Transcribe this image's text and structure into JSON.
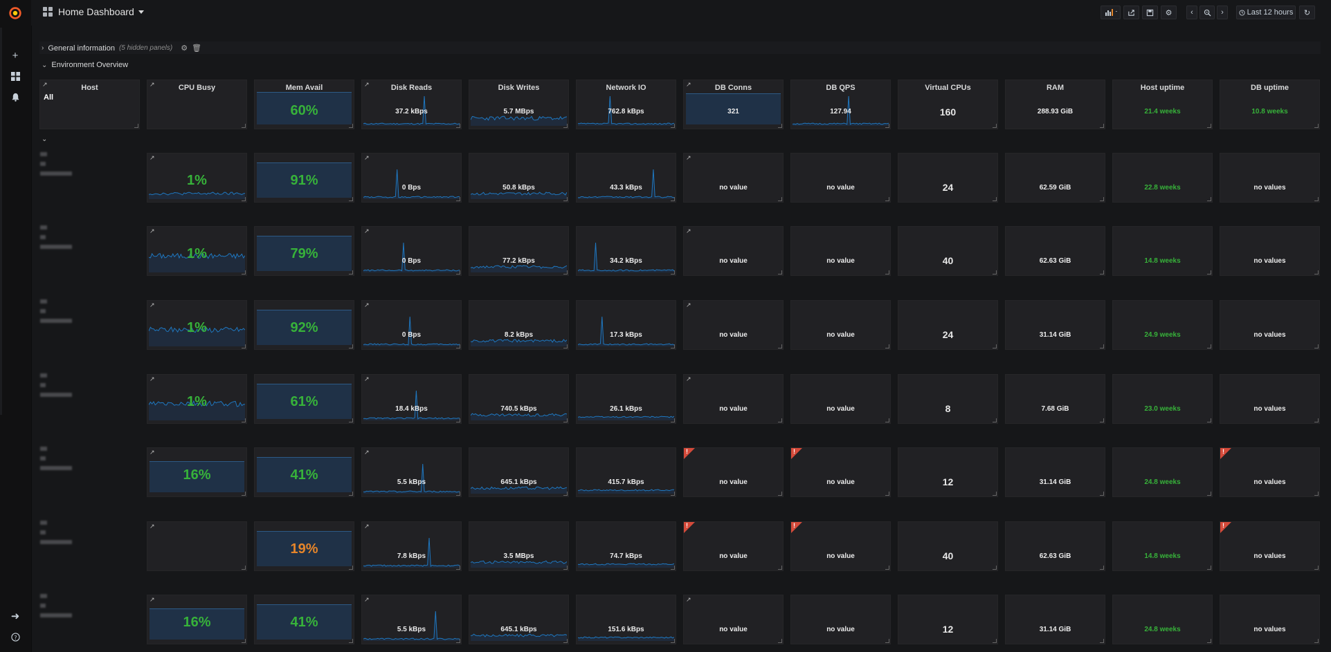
{
  "topbar": {
    "title": "Home Dashboard",
    "time_range": "Last 12 hours"
  },
  "rows": {
    "general": {
      "title": "General information",
      "hidden_note": "(5 hidden panels)"
    },
    "env": {
      "title": "Environment Overview"
    }
  },
  "header": {
    "host": {
      "title": "Host",
      "value": "All"
    },
    "cpu": {
      "title": "CPU Busy"
    },
    "mem": {
      "title": "Mem Avail",
      "value": "60%"
    },
    "disk_reads": {
      "title": "Disk Reads",
      "value": "37.2 kBps"
    },
    "disk_writes": {
      "title": "Disk Writes",
      "value": "5.7 MBps"
    },
    "network_io": {
      "title": "Network IO",
      "value": "762.8 kBps"
    },
    "db_conns": {
      "title": "DB Conns",
      "value": "321"
    },
    "db_qps": {
      "title": "DB QPS",
      "value": "127.94"
    },
    "vcpus": {
      "title": "Virtual CPUs",
      "value": "160"
    },
    "ram": {
      "title": "RAM",
      "value": "288.93 GiB"
    },
    "host_uptime": {
      "title": "Host uptime",
      "value": "21.4 weeks"
    },
    "db_uptime": {
      "title": "DB uptime",
      "value": "10.8 weeks"
    }
  },
  "hosts": [
    {
      "cpu": "1%",
      "mem": "91%",
      "reads": "0 Bps",
      "writes": "50.8 kBps",
      "net": "43.3 kBps",
      "dbconns": "no value",
      "dbqps": "no value",
      "vcpus": "24",
      "ram": "62.59 GiB",
      "uptime": "22.8 weeks",
      "dbuptime": "no values"
    },
    {
      "cpu": "1%",
      "mem": "79%",
      "reads": "0 Bps",
      "writes": "77.2 kBps",
      "net": "34.2 kBps",
      "dbconns": "no value",
      "dbqps": "no value",
      "vcpus": "40",
      "ram": "62.63 GiB",
      "uptime": "14.8 weeks",
      "dbuptime": "no values"
    },
    {
      "cpu": "1%",
      "mem": "92%",
      "reads": "0 Bps",
      "writes": "8.2 kBps",
      "net": "17.3 kBps",
      "dbconns": "no value",
      "dbqps": "no value",
      "vcpus": "24",
      "ram": "31.14 GiB",
      "uptime": "24.9 weeks",
      "dbuptime": "no values"
    },
    {
      "cpu": "1%",
      "mem": "61%",
      "reads": "18.4 kBps",
      "writes": "740.5 kBps",
      "net": "26.1 kBps",
      "dbconns": "no value",
      "dbqps": "no value",
      "vcpus": "8",
      "ram": "7.68 GiB",
      "uptime": "23.0 weeks",
      "dbuptime": "no values"
    },
    {
      "cpu": "16%",
      "mem": "41%",
      "reads": "5.5 kBps",
      "writes": "645.1 kBps",
      "net": "415.7 kBps",
      "dbconns": "no value",
      "dbqps": "no value",
      "vcpus": "12",
      "ram": "31.14 GiB",
      "uptime": "24.8 weeks",
      "dbuptime": "no values",
      "errors": true
    },
    {
      "cpu": "",
      "mem": "19%",
      "reads": "7.8 kBps",
      "writes": "3.5 MBps",
      "net": "74.7 kBps",
      "dbconns": "no value",
      "dbqps": "no value",
      "vcpus": "40",
      "ram": "62.63 GiB",
      "uptime": "14.8 weeks",
      "dbuptime": "no values",
      "errors": true,
      "mem_color": "orange"
    },
    {
      "cpu": "16%",
      "mem": "41%",
      "reads": "5.5 kBps",
      "writes": "645.1 kBps",
      "net": "151.6 kBps",
      "dbconns": "no value",
      "dbqps": "no value",
      "vcpus": "12",
      "ram": "31.14 GiB",
      "uptime": "24.8 weeks",
      "dbuptime": "no values"
    }
  ],
  "colors": {
    "green": "#37b23a",
    "orange": "#e5852a",
    "fill": "#1f3147",
    "line": "#1f78c1",
    "error": "#d44a3a"
  }
}
